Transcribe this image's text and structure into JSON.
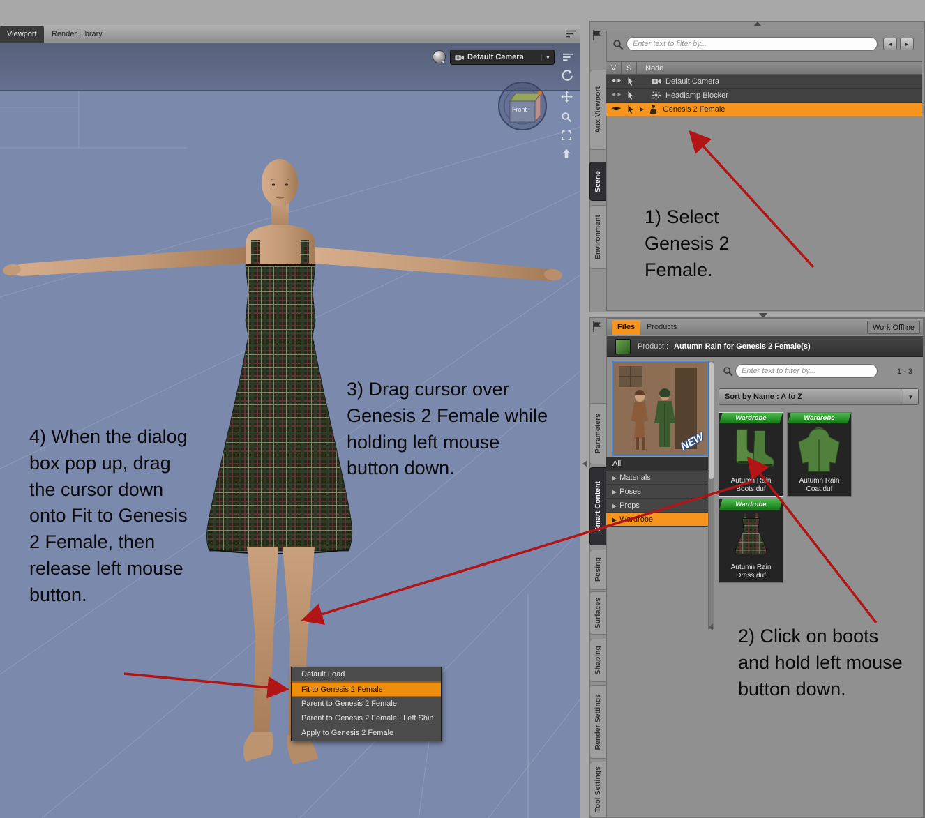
{
  "colors": {
    "accent_orange": "#f7941d",
    "arrow_red": "#b11515",
    "viewport_blue": "#7b89ad",
    "badge_green": "#2e9b2e"
  },
  "left_tabs": {
    "viewport": "Viewport",
    "render_library": "Render Library"
  },
  "viewport": {
    "camera_label": "Default Camera",
    "view_cube_face": "Front",
    "context_menu": {
      "items": [
        "Default Load",
        "Fit to Genesis 2 Female",
        "Parent to Genesis 2 Female",
        "Parent to Genesis 2 Female : Left Shin",
        "Apply to Genesis 2 Female"
      ],
      "highlighted_item": "Fit to Genesis 2 Female"
    }
  },
  "annotations": {
    "step1": "1) Select Genesis 2 Female.",
    "step2": "2) Click on boots and hold left mouse button down.",
    "step3": "3) Drag cursor over Genesis 2 Female while holding left mouse button down.",
    "step4": "4) When the dialog box pop up, drag the cursor down onto Fit to Genesis 2 Female, then release left mouse button."
  },
  "scene_panel": {
    "side_tabs": [
      "Aux Viewport",
      "Scene",
      "Environment"
    ],
    "active_side_tab": "Scene",
    "filter_placeholder": "Enter text to filter by...",
    "columns": {
      "v": "V",
      "s": "S",
      "node": "Node"
    },
    "nodes": [
      {
        "label": "Default Camera",
        "type": "camera"
      },
      {
        "label": "Headlamp Blocker",
        "type": "light"
      },
      {
        "label": "Genesis 2 Female",
        "type": "figure",
        "selected": true
      }
    ]
  },
  "content_panel": {
    "side_tabs": [
      "Parameters",
      "Smart Content",
      "Posing",
      "Surfaces",
      "Shaping",
      "Render Settings",
      "Tool Settings"
    ],
    "active_side_tab": "Smart Content",
    "file_tabs": {
      "files": "Files",
      "products": "Products"
    },
    "work_offline": "Work Offline",
    "product_label": "Product :",
    "product_name": "Autumn Rain for Genesis 2 Female(s)",
    "product_badge": "NEW",
    "categories": [
      "All",
      "Materials",
      "Poses",
      "Props",
      "Wardrobe"
    ],
    "selected_category": "Wardrobe",
    "filter_placeholder": "Enter text to filter by...",
    "result_range": "1 - 3",
    "sort_label": "Sort by Name : A to Z",
    "items": [
      {
        "name": "Autumn Rain Boots.duf",
        "badge": "Wardrobe"
      },
      {
        "name": "Autumn Rain Coat.duf",
        "badge": "Wardrobe"
      },
      {
        "name": "Autumn Rain Dress.duf",
        "badge": "Wardrobe"
      }
    ]
  }
}
